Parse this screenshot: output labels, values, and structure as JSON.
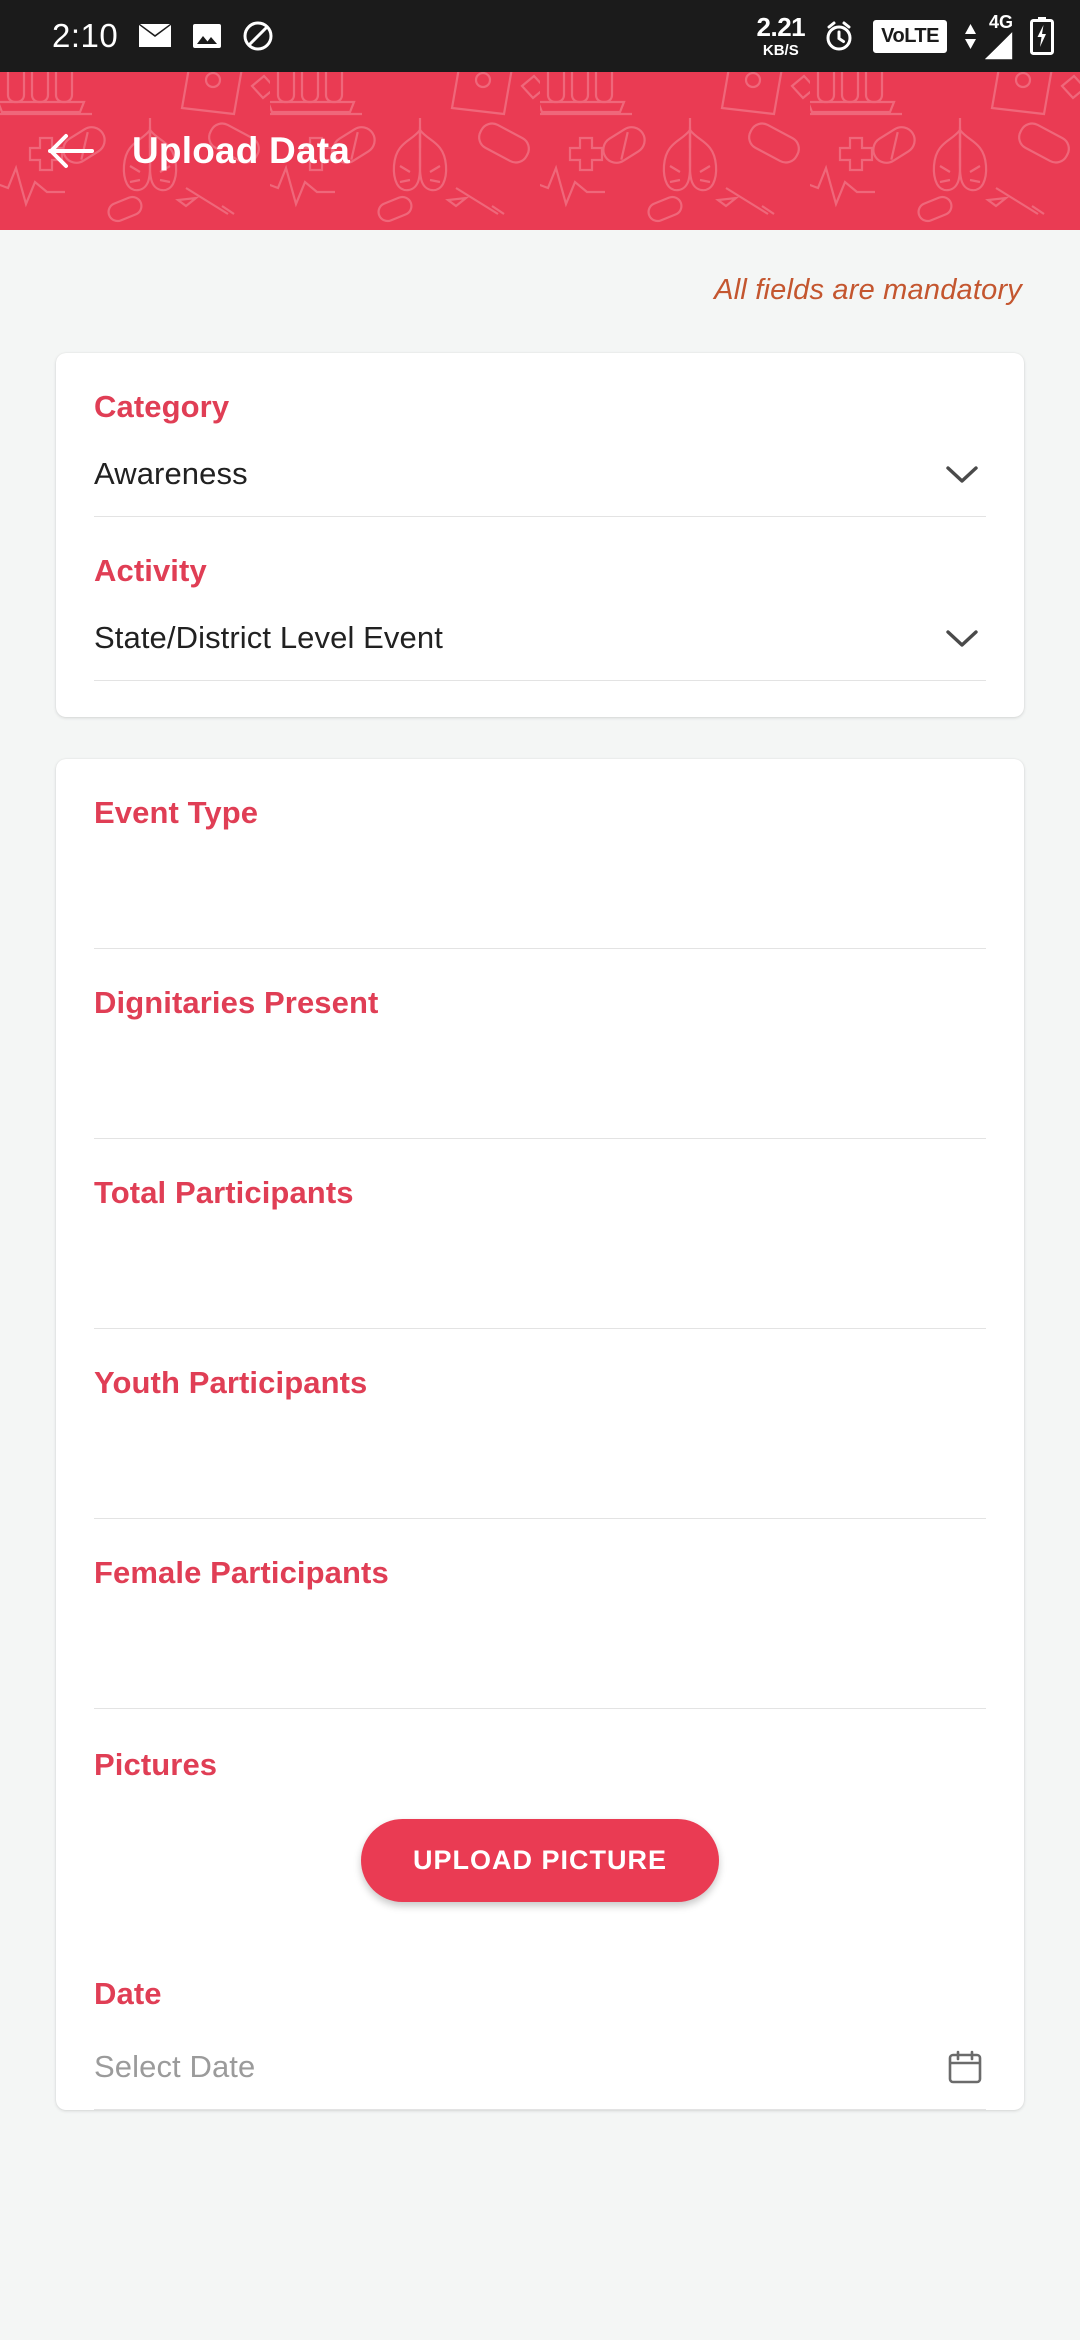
{
  "status_bar": {
    "time": "2:10",
    "net_speed_value": "2.21",
    "net_speed_unit": "KB/S",
    "volte_label": "VoLTE",
    "network_type": "4G",
    "icons": {
      "email": "email-icon",
      "screenshot": "image-icon",
      "do_not_disturb": "do-not-disturb-icon",
      "alarm": "alarm-icon",
      "signal": "signal-bars-icon",
      "battery": "battery-charging-icon"
    }
  },
  "app_bar": {
    "title": "Upload Data",
    "back_icon": "arrow-left-icon",
    "background_color": "#ea3b53"
  },
  "mandatory_note": "All fields are mandatory",
  "colors": {
    "accent": "#ea3b53",
    "label": "#e03e55",
    "note": "#c4562f",
    "page_bg": "#f4f6f5",
    "card_bg": "#ffffff"
  },
  "card_one": {
    "fields": [
      {
        "label": "Category",
        "value": "Awareness",
        "type": "dropdown",
        "icon": "chevron-down-icon"
      },
      {
        "label": "Activity",
        "value": "State/District Level Event",
        "type": "dropdown",
        "icon": "chevron-down-icon"
      }
    ]
  },
  "card_two": {
    "fields": [
      {
        "label": "Event Type",
        "value": "",
        "placeholder": "",
        "type": "text"
      },
      {
        "label": "Dignitaries Present",
        "value": "",
        "placeholder": "",
        "type": "text"
      },
      {
        "label": "Total Participants",
        "value": "",
        "placeholder": "",
        "type": "number"
      },
      {
        "label": "Youth Participants",
        "value": "",
        "placeholder": "",
        "type": "number"
      },
      {
        "label": "Female Participants",
        "value": "",
        "placeholder": "",
        "type": "number"
      }
    ],
    "pictures": {
      "label": "Pictures",
      "button_label": "UPLOAD PICTURE"
    },
    "date": {
      "label": "Date",
      "placeholder": "Select Date",
      "icon": "calendar-icon"
    }
  }
}
